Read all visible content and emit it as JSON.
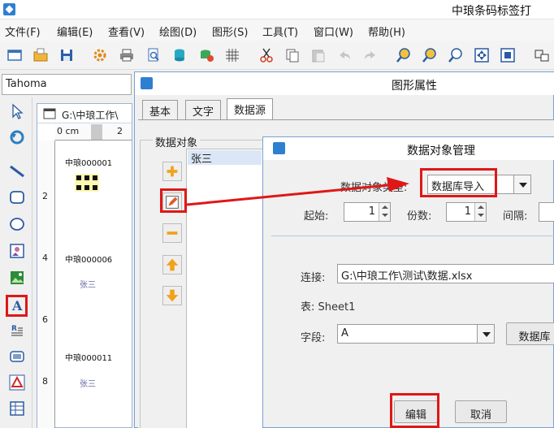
{
  "app": {
    "title": "中琅条码标签打"
  },
  "menu": [
    "文件(F)",
    "编辑(E)",
    "查看(V)",
    "绘图(D)",
    "图形(S)",
    "工具(T)",
    "窗口(W)",
    "帮助(H)"
  ],
  "font_combo": {
    "value": "Tahoma"
  },
  "document": {
    "title": "G:\\中琅工作\\",
    "ruler_top": [
      "0 cm",
      "2"
    ],
    "ruler_left": [
      "2",
      "4",
      "6",
      "8"
    ],
    "labels": [
      {
        "code": "中琅000001",
        "name": ""
      },
      {
        "code": "中琅000006",
        "name": "张三"
      },
      {
        "code": "中琅000011",
        "name": "张三"
      }
    ]
  },
  "prop_dialog": {
    "title": "图形属性",
    "tabs": [
      "基本",
      "文字",
      "数据源"
    ],
    "group_title": "数据对象",
    "list_items": [
      "张三"
    ]
  },
  "data_dialog": {
    "title": "数据对象管理",
    "type_label": "数据对象类型:",
    "type_value": "数据库导入",
    "start_label": "起始:",
    "start_value": "1",
    "copies_label": "份数:",
    "copies_value": "1",
    "interval_label": "间隔:",
    "connection_label": "连接:",
    "connection_value": "G:\\中琅工作\\测试\\数据.xlsx",
    "table_label": "表: Sheet1",
    "field_label": "字段:",
    "field_value": "A",
    "db_button": "数据库",
    "edit_button": "编辑",
    "cancel_button": "取消"
  },
  "colors": {
    "highlight": "#e01717",
    "accent": "#2f7fd1"
  }
}
